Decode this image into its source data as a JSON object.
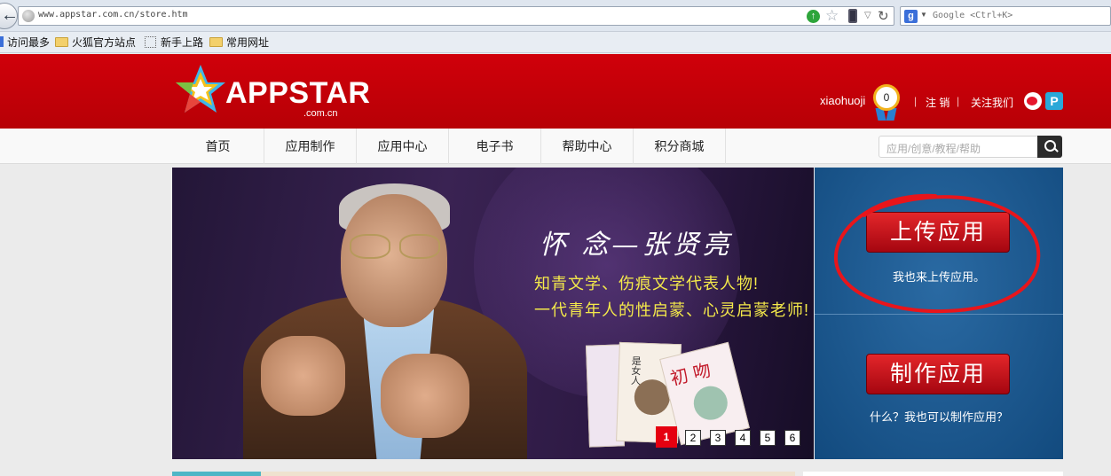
{
  "browser": {
    "url": "www.appstar.com.cn/store.htm",
    "search_placeholder": "Google <Ctrl+K>",
    "bookmarks": [
      "访问最多",
      "火狐官方站点",
      "新手上路",
      "常用网址"
    ]
  },
  "header": {
    "logo_text": "APPSTAR",
    "logo_sub": ".com.cn",
    "username": "xiaohuoji",
    "points": "0",
    "logout": "注 销",
    "follow": "关注我们",
    "separator": "|"
  },
  "nav": {
    "items": [
      "首页",
      "应用制作",
      "应用中心",
      "电子书",
      "帮助中心",
      "积分商城"
    ],
    "search_placeholder": "应用/创意/教程/帮助"
  },
  "banner": {
    "title": "怀 念—张贤亮",
    "line1": "知青文学、伤痕文学代表人物!",
    "line2": "一代青年人的性启蒙、心灵启蒙老师!",
    "book1_label": "是女人",
    "book2_label": "初吻",
    "pages": [
      "1",
      "2",
      "3",
      "4",
      "5",
      "6"
    ],
    "active_page": "1"
  },
  "side": {
    "upload_button": "上传应用",
    "upload_desc": "我也来上传应用。",
    "make_button": "制作应用",
    "make_desc": "什么？我也可以制作应用？"
  },
  "colors": {
    "header_red": "#c8000a",
    "side_blue": "#1d5a92",
    "button_red": "#c8141c",
    "annotation_red": "#e8151b"
  }
}
